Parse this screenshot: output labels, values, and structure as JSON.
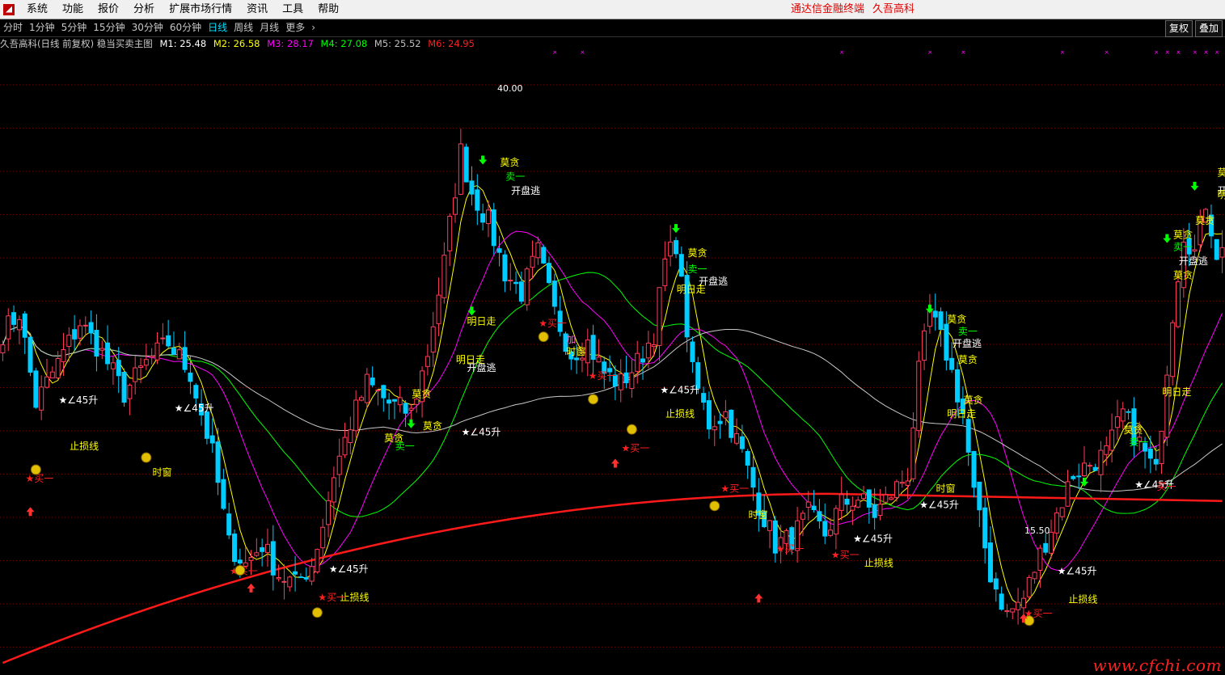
{
  "menubar": {
    "items": [
      "系统",
      "功能",
      "报价",
      "分析",
      "扩展市场行情",
      "资讯",
      "工具",
      "帮助"
    ],
    "app_name": "通达信金融终端",
    "stock_name": "久吾高科"
  },
  "periods": {
    "items": [
      "分时",
      "1分钟",
      "5分钟",
      "15分钟",
      "30分钟",
      "60分钟",
      "日线",
      "周线",
      "月线",
      "更多"
    ],
    "active": "日线",
    "more_icon": "chevron-right-icon",
    "fuquan_label": "复权",
    "overlay_label": "叠加"
  },
  "info": {
    "title": "久吾高科(日线 前复权) 稳当买卖主图",
    "mas": [
      {
        "label": "M1: 25.48",
        "color": "#ffffff"
      },
      {
        "label": "M2: 26.58",
        "color": "#ffff00"
      },
      {
        "label": "M3: 28.17",
        "color": "#ff00ff"
      },
      {
        "label": "M4: 27.08",
        "color": "#00ff00"
      },
      {
        "label": "M5: 25.52",
        "color": "#c0c0c0"
      },
      {
        "label": "M6: 24.95",
        "color": "#ff2020"
      }
    ]
  },
  "chart_data": {
    "type": "candlestick",
    "high_label": "40.00",
    "low_label": "15.50",
    "ylim": [
      13,
      44
    ],
    "colors": {
      "up": "#ff3c5a",
      "down": "#00ccff",
      "ma_fast": "#ffff00",
      "ma_mid": "#ff00ff",
      "ma_slow": "#00ff00",
      "ma_long": "#c8c8c8",
      "ma_longest": "#ff1a1a"
    },
    "key_points": [
      [
        0,
        30
      ],
      [
        3,
        31
      ],
      [
        6,
        26.5
      ],
      [
        10,
        28.5
      ],
      [
        14,
        30.5
      ],
      [
        18,
        29
      ],
      [
        22,
        27
      ],
      [
        26,
        28.5
      ],
      [
        30,
        29.5
      ],
      [
        34,
        28
      ],
      [
        38,
        24
      ],
      [
        41,
        19.5
      ],
      [
        44,
        18.5
      ],
      [
        47,
        19.5
      ],
      [
        50,
        18
      ],
      [
        53,
        17.5
      ],
      [
        56,
        18.5
      ],
      [
        58,
        20.5
      ],
      [
        60,
        23
      ],
      [
        63,
        25.5
      ],
      [
        66,
        27.5
      ],
      [
        70,
        26.5
      ],
      [
        74,
        26
      ],
      [
        77,
        29
      ],
      [
        80,
        33.5
      ],
      [
        83,
        39
      ],
      [
        85,
        37
      ],
      [
        88,
        35.5
      ],
      [
        91,
        33
      ],
      [
        94,
        32
      ],
      [
        97,
        34
      ],
      [
        100,
        31
      ],
      [
        103,
        29
      ],
      [
        106,
        29.5
      ],
      [
        109,
        28
      ],
      [
        112,
        27.5
      ],
      [
        115,
        28.5
      ],
      [
        118,
        30
      ],
      [
        120,
        33.5
      ],
      [
        122,
        34.5
      ],
      [
        125,
        28
      ],
      [
        128,
        25.5
      ],
      [
        131,
        26
      ],
      [
        134,
        24
      ],
      [
        137,
        21.5
      ],
      [
        140,
        19.5
      ],
      [
        143,
        19.8
      ],
      [
        146,
        21
      ],
      [
        149,
        20
      ],
      [
        152,
        21.5
      ],
      [
        155,
        21.8
      ],
      [
        158,
        21
      ],
      [
        161,
        22
      ],
      [
        164,
        23
      ],
      [
        166,
        28
      ],
      [
        168,
        31
      ],
      [
        171,
        29
      ],
      [
        174,
        26
      ],
      [
        176,
        22
      ],
      [
        179,
        18
      ],
      [
        182,
        16
      ],
      [
        185,
        16.8
      ],
      [
        188,
        19
      ],
      [
        191,
        21
      ],
      [
        194,
        23
      ],
      [
        197,
        23.5
      ],
      [
        200,
        24
      ],
      [
        203,
        26
      ],
      [
        206,
        24.5
      ],
      [
        209,
        23
      ],
      [
        212,
        31
      ],
      [
        214,
        35
      ],
      [
        216,
        34
      ],
      [
        218,
        36.5
      ],
      [
        220,
        34
      ]
    ],
    "marks": [
      {
        "t": "莫贪",
        "c": "#ffff00",
        "i": 91,
        "v": 38.3
      },
      {
        "t": "卖一",
        "c": "#00ff00",
        "i": 92,
        "v": 37.6
      },
      {
        "t": "开盘逃",
        "c": "#ffffff",
        "i": 93,
        "v": 36.9
      },
      {
        "t": "明日走",
        "c": "#ffff00",
        "i": 85,
        "v": 30.4
      },
      {
        "t": "明日走",
        "c": "#ffff00",
        "i": 83,
        "v": 28.5
      },
      {
        "t": "开盘逃",
        "c": "#ffffff",
        "i": 85,
        "v": 28.1
      },
      {
        "t": "莫贪",
        "c": "#ffff00",
        "i": 75,
        "v": 26.8
      },
      {
        "t": "莫贪",
        "c": "#ffff00",
        "i": 77,
        "v": 25.2
      },
      {
        "t": "莫贪",
        "c": "#ffff00",
        "i": 70,
        "v": 24.6
      },
      {
        "t": "卖一",
        "c": "#00ff00",
        "i": 72,
        "v": 24.2
      },
      {
        "t": "莫贪",
        "c": "#ffff00",
        "i": 125,
        "v": 33.8
      },
      {
        "t": "卖一",
        "c": "#00ff00",
        "i": 125,
        "v": 33.0
      },
      {
        "t": "开盘逃",
        "c": "#ffffff",
        "i": 127,
        "v": 32.4
      },
      {
        "t": "明日走",
        "c": "#ffff00",
        "i": 123,
        "v": 32.0
      },
      {
        "t": "加",
        "c": "#ff66cc",
        "i": 103,
        "v": 29.5
      },
      {
        "t": "时窗",
        "c": "#ffff00",
        "i": 103,
        "v": 28.9
      },
      {
        "t": "莫贪",
        "c": "#ffff00",
        "i": 172,
        "v": 30.5
      },
      {
        "t": "卖一",
        "c": "#00ff00",
        "i": 174,
        "v": 29.9
      },
      {
        "t": "开盘逃",
        "c": "#ffffff",
        "i": 173,
        "v": 29.3
      },
      {
        "t": "莫贪",
        "c": "#ffff00",
        "i": 174,
        "v": 28.5
      },
      {
        "t": "莫贪",
        "c": "#ffff00",
        "i": 213,
        "v": 34.7
      },
      {
        "t": "卖一",
        "c": "#00ff00",
        "i": 213,
        "v": 34.1
      },
      {
        "t": "开盘逃",
        "c": "#ffffff",
        "i": 214,
        "v": 33.4
      },
      {
        "t": "莫贪",
        "c": "#ffff00",
        "i": 217,
        "v": 35.4
      },
      {
        "t": "莫贪",
        "c": "#ffff00",
        "i": 213,
        "v": 32.7
      },
      {
        "t": "明日走",
        "c": "#ffff00",
        "i": 211,
        "v": 26.9
      },
      {
        "t": "莫贪",
        "c": "#ffff00",
        "i": 221,
        "v": 37.8
      },
      {
        "t": "开盘逃",
        "c": "#ffffff",
        "i": 221,
        "v": 36.9
      },
      {
        "t": "明日走",
        "c": "#ffff00",
        "i": 221,
        "v": 36.7
      },
      {
        "t": "莫贪",
        "c": "#ffff00",
        "i": 175,
        "v": 26.5
      },
      {
        "t": "莫贪",
        "c": "#ffff00",
        "i": 204,
        "v": 25.0
      },
      {
        "t": "卖一",
        "c": "#00ff00",
        "i": 205,
        "v": 24.4
      },
      {
        "t": "明日走",
        "c": "#ffff00",
        "i": 172,
        "v": 25.8
      },
      {
        "t": "★∠45升",
        "c": "#ffffff",
        "i": 11,
        "v": 26.5
      },
      {
        "t": "止损线",
        "c": "#ffff00",
        "i": 13,
        "v": 24.2
      },
      {
        "t": "★买一",
        "c": "#ff2020",
        "i": 5,
        "v": 22.6
      },
      {
        "t": "★∠45升",
        "c": "#ffffff",
        "i": 32,
        "v": 26.1
      },
      {
        "t": "时窗",
        "c": "#ffff00",
        "i": 28,
        "v": 22.9
      },
      {
        "t": "★买一",
        "c": "#ff2020",
        "i": 42,
        "v": 18.0
      },
      {
        "t": "★∠45升",
        "c": "#ffffff",
        "i": 60,
        "v": 18.1
      },
      {
        "t": "止损线",
        "c": "#ffff00",
        "i": 62,
        "v": 16.7
      },
      {
        "t": "★买一",
        "c": "#ff2020",
        "i": 58,
        "v": 16.7
      },
      {
        "t": "★∠45升",
        "c": "#ffffff",
        "i": 84,
        "v": 24.9
      },
      {
        "t": "★买一",
        "c": "#ff2020",
        "i": 98,
        "v": 30.3
      },
      {
        "t": "★买一",
        "c": "#ff2020",
        "i": 107,
        "v": 27.7
      },
      {
        "t": "★买一",
        "c": "#ff2020",
        "i": 113,
        "v": 24.1
      },
      {
        "t": "★∠45升",
        "c": "#ffffff",
        "i": 120,
        "v": 27.0
      },
      {
        "t": "止损线",
        "c": "#ffff00",
        "i": 121,
        "v": 25.8
      },
      {
        "t": "★买一",
        "c": "#ff2020",
        "i": 131,
        "v": 22.1
      },
      {
        "t": "时窗",
        "c": "#ffff00",
        "i": 136,
        "v": 20.8
      },
      {
        "t": "★买一",
        "c": "#ff2020",
        "i": 141,
        "v": 19.1
      },
      {
        "t": "★买一",
        "c": "#ff2020",
        "i": 151,
        "v": 18.8
      },
      {
        "t": "★∠45升",
        "c": "#ffffff",
        "i": 155,
        "v": 19.6
      },
      {
        "t": "止损线",
        "c": "#ffff00",
        "i": 157,
        "v": 18.4
      },
      {
        "t": "★∠45升",
        "c": "#ffffff",
        "i": 167,
        "v": 21.3
      },
      {
        "t": "时窗",
        "c": "#ffff00",
        "i": 170,
        "v": 22.1
      },
      {
        "t": "★买一",
        "c": "#ff2020",
        "i": 186,
        "v": 15.9
      },
      {
        "t": "★∠45升",
        "c": "#ffffff",
        "i": 192,
        "v": 18.0
      },
      {
        "t": "止损线",
        "c": "#ffff00",
        "i": 194,
        "v": 16.6
      },
      {
        "t": "★∠45升",
        "c": "#ffffff",
        "i": 206,
        "v": 22.3
      },
      {
        "t": "买一",
        "c": "#ff2020",
        "i": 210,
        "v": 22.2
      }
    ],
    "face_icons": [
      [
        6,
        23.2
      ],
      [
        26,
        23.8
      ],
      [
        43,
        18.2
      ],
      [
        57,
        16.1
      ],
      [
        98,
        29.8
      ],
      [
        107,
        26.7
      ],
      [
        114,
        25.2
      ],
      [
        129,
        21.4
      ],
      [
        186,
        15.7
      ]
    ],
    "up_arrows": [
      [
        5,
        21.1
      ],
      [
        45,
        17.3
      ],
      [
        111,
        23.5
      ],
      [
        137,
        16.8
      ],
      [
        185,
        15.8
      ]
    ],
    "sell_arrows": [
      [
        85,
        31.1
      ],
      [
        87,
        38.6
      ],
      [
        74,
        25.5
      ],
      [
        122,
        35.2
      ],
      [
        168,
        31.2
      ],
      [
        196,
        22.6
      ],
      [
        211,
        34.7
      ],
      [
        216,
        37.3
      ]
    ],
    "top_x_marks": [
      100,
      105,
      152,
      168,
      174,
      192,
      200,
      209,
      211,
      213,
      216,
      218,
      220
    ]
  }
}
